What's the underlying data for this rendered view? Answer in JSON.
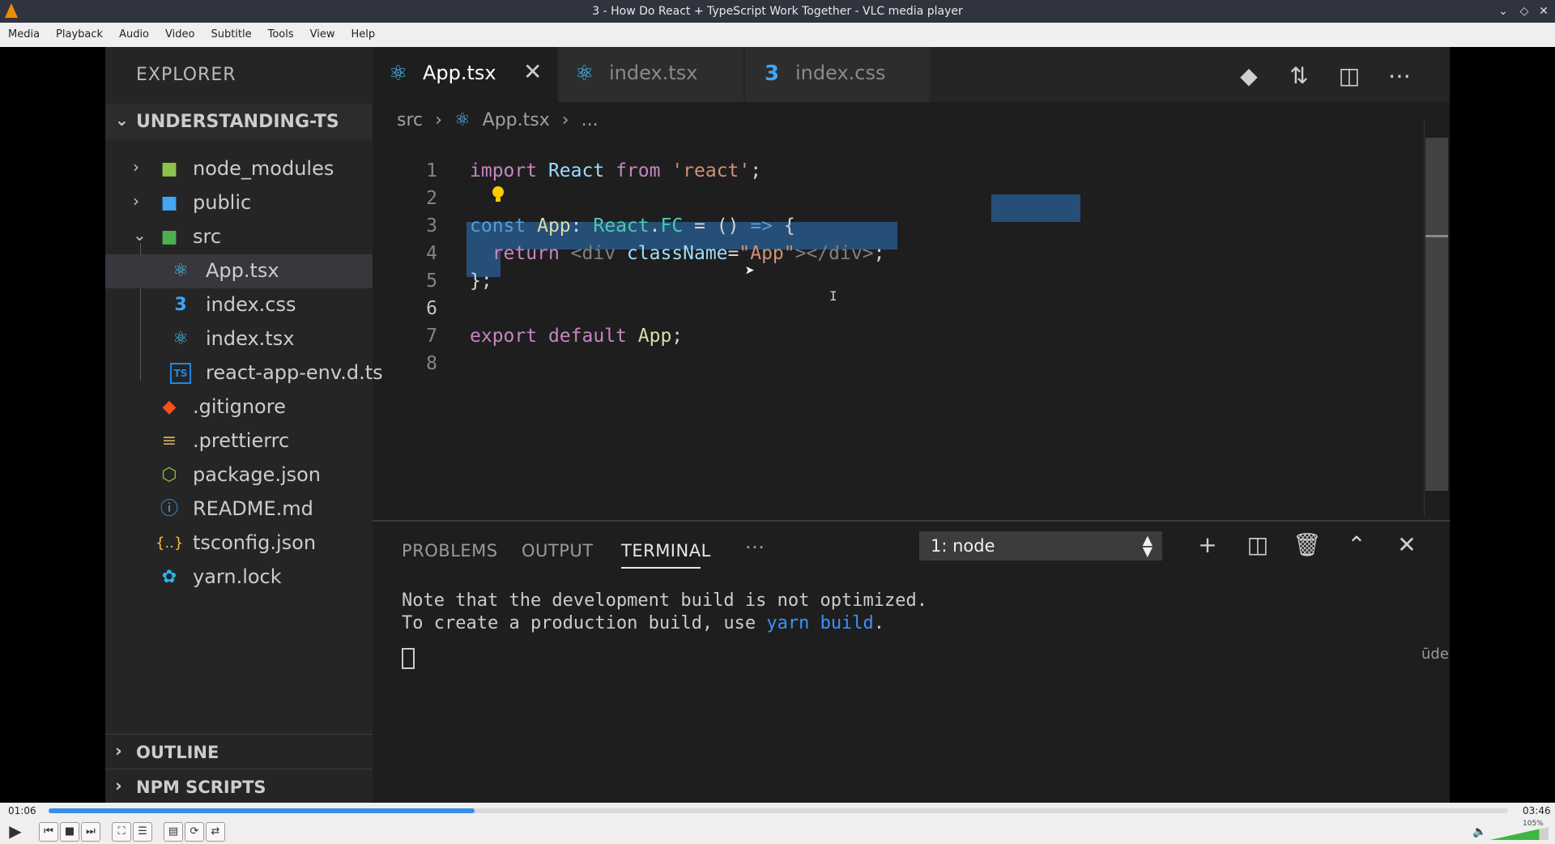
{
  "window": {
    "title": "3 - How Do React + TypeScript Work Together - VLC media player"
  },
  "menu": [
    "Media",
    "Playback",
    "Audio",
    "Video",
    "Subtitle",
    "Tools",
    "View",
    "Help"
  ],
  "explorer": {
    "title": "EXPLORER",
    "project": "UNDERSTANDING-TS",
    "items": [
      {
        "label": "node_modules",
        "icon": "folder-node-icon"
      },
      {
        "label": "public",
        "icon": "folder-public-icon"
      },
      {
        "label": "src",
        "icon": "folder-src-icon"
      },
      {
        "label": "App.tsx",
        "icon": "react-icon"
      },
      {
        "label": "index.css",
        "icon": "css-icon"
      },
      {
        "label": "index.tsx",
        "icon": "react-icon"
      },
      {
        "label": "react-app-env.d.ts",
        "icon": "typescript-icon"
      },
      {
        "label": ".gitignore",
        "icon": "git-icon"
      },
      {
        "label": ".prettierrc",
        "icon": "prettier-icon"
      },
      {
        "label": "package.json",
        "icon": "nodejs-icon"
      },
      {
        "label": "README.md",
        "icon": "info-icon"
      },
      {
        "label": "tsconfig.json",
        "icon": "json-icon"
      },
      {
        "label": "yarn.lock",
        "icon": "yarn-icon"
      }
    ],
    "outline": "OUTLINE",
    "npm_scripts": "NPM SCRIPTS"
  },
  "tabs": [
    {
      "label": "App.tsx",
      "active": true
    },
    {
      "label": "index.tsx",
      "active": false
    },
    {
      "label": "index.css",
      "active": false
    }
  ],
  "breadcrumb": {
    "folder": "src",
    "file": "App.tsx",
    "more": "..."
  },
  "code": {
    "line_numbers": [
      "1",
      "2",
      "3",
      "4",
      "5",
      "6",
      "7",
      "8"
    ],
    "l1": {
      "kw": "import",
      "id": "React",
      "kw2": "from",
      "str": "'react'",
      "end": ";"
    },
    "l3": {
      "kw": "const",
      "name": "App",
      "colon": ":",
      "ns": "React",
      "dot": ".",
      "type": "FC",
      "eq": "=",
      "args": "()",
      "arrow": "=>",
      "brace": "{"
    },
    "l4": {
      "kw": "return",
      "open": "<div",
      "attr": "className",
      "eq": "=",
      "str": "\"App\"",
      "close": "></div>",
      "semi": ";"
    },
    "l5": {
      "end": "};"
    },
    "l7": {
      "kw": "export",
      "kw2": "default",
      "name": "App",
      "semi": ";"
    }
  },
  "panel": {
    "tabs": [
      "PROBLEMS",
      "OUTPUT",
      "TERMINAL"
    ],
    "more": "···",
    "terminal_select": "1: node",
    "line1": "Note that the development build is not optimized.",
    "line2_prefix": "To create a production build, use ",
    "line2_link": "yarn build",
    "line2_suffix": ".",
    "watermark": "ūdemy"
  },
  "player": {
    "elapsed": "01:06",
    "total": "03:46",
    "progress_fraction": 0.292,
    "volume_label": "105%",
    "volume_fraction": 0.84
  }
}
